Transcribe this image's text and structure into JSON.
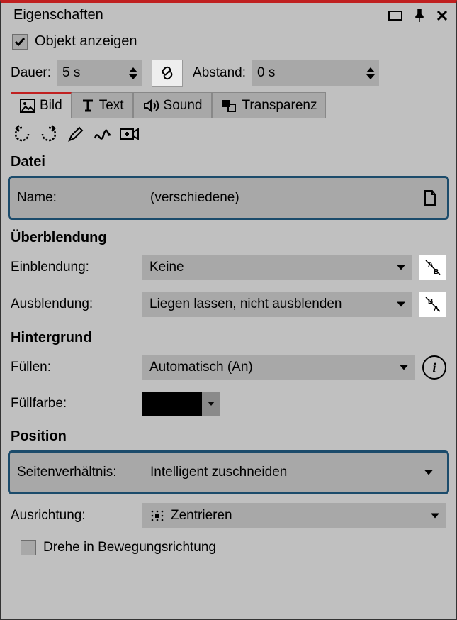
{
  "header": {
    "title": "Eigenschaften"
  },
  "objectShow": {
    "label": "Objekt anzeigen",
    "checked": true
  },
  "duration": {
    "label": "Dauer:",
    "value": "5 s"
  },
  "distance": {
    "label": "Abstand:",
    "value": "0 s"
  },
  "tabs": {
    "bild": "Bild",
    "text": "Text",
    "sound": "Sound",
    "transparenz": "Transparenz"
  },
  "sections": {
    "datei": "Datei",
    "ueberblendung": "Überblendung",
    "hintergrund": "Hintergrund",
    "position": "Position"
  },
  "datei": {
    "nameLabel": "Name:",
    "nameValue": "(verschiedene)"
  },
  "ueberblendung": {
    "einLabel": "Einblendung:",
    "einValue": "Keine",
    "ausLabel": "Ausblendung:",
    "ausValue": "Liegen lassen, nicht ausblenden"
  },
  "hintergrund": {
    "fuellenLabel": "Füllen:",
    "fuellenValue": "Automatisch (An)",
    "fuellfarbeLabel": "Füllfarbe:",
    "fuellfarbeHex": "#000000"
  },
  "position": {
    "seitenLabel": "Seitenverhältnis:",
    "seitenValue": "Intelligent zuschneiden",
    "ausrichtungLabel": "Ausrichtung:",
    "ausrichtungValue": "Zentrieren",
    "dreheLabel": "Drehe in Bewegungsrichtung",
    "dreheChecked": false
  }
}
